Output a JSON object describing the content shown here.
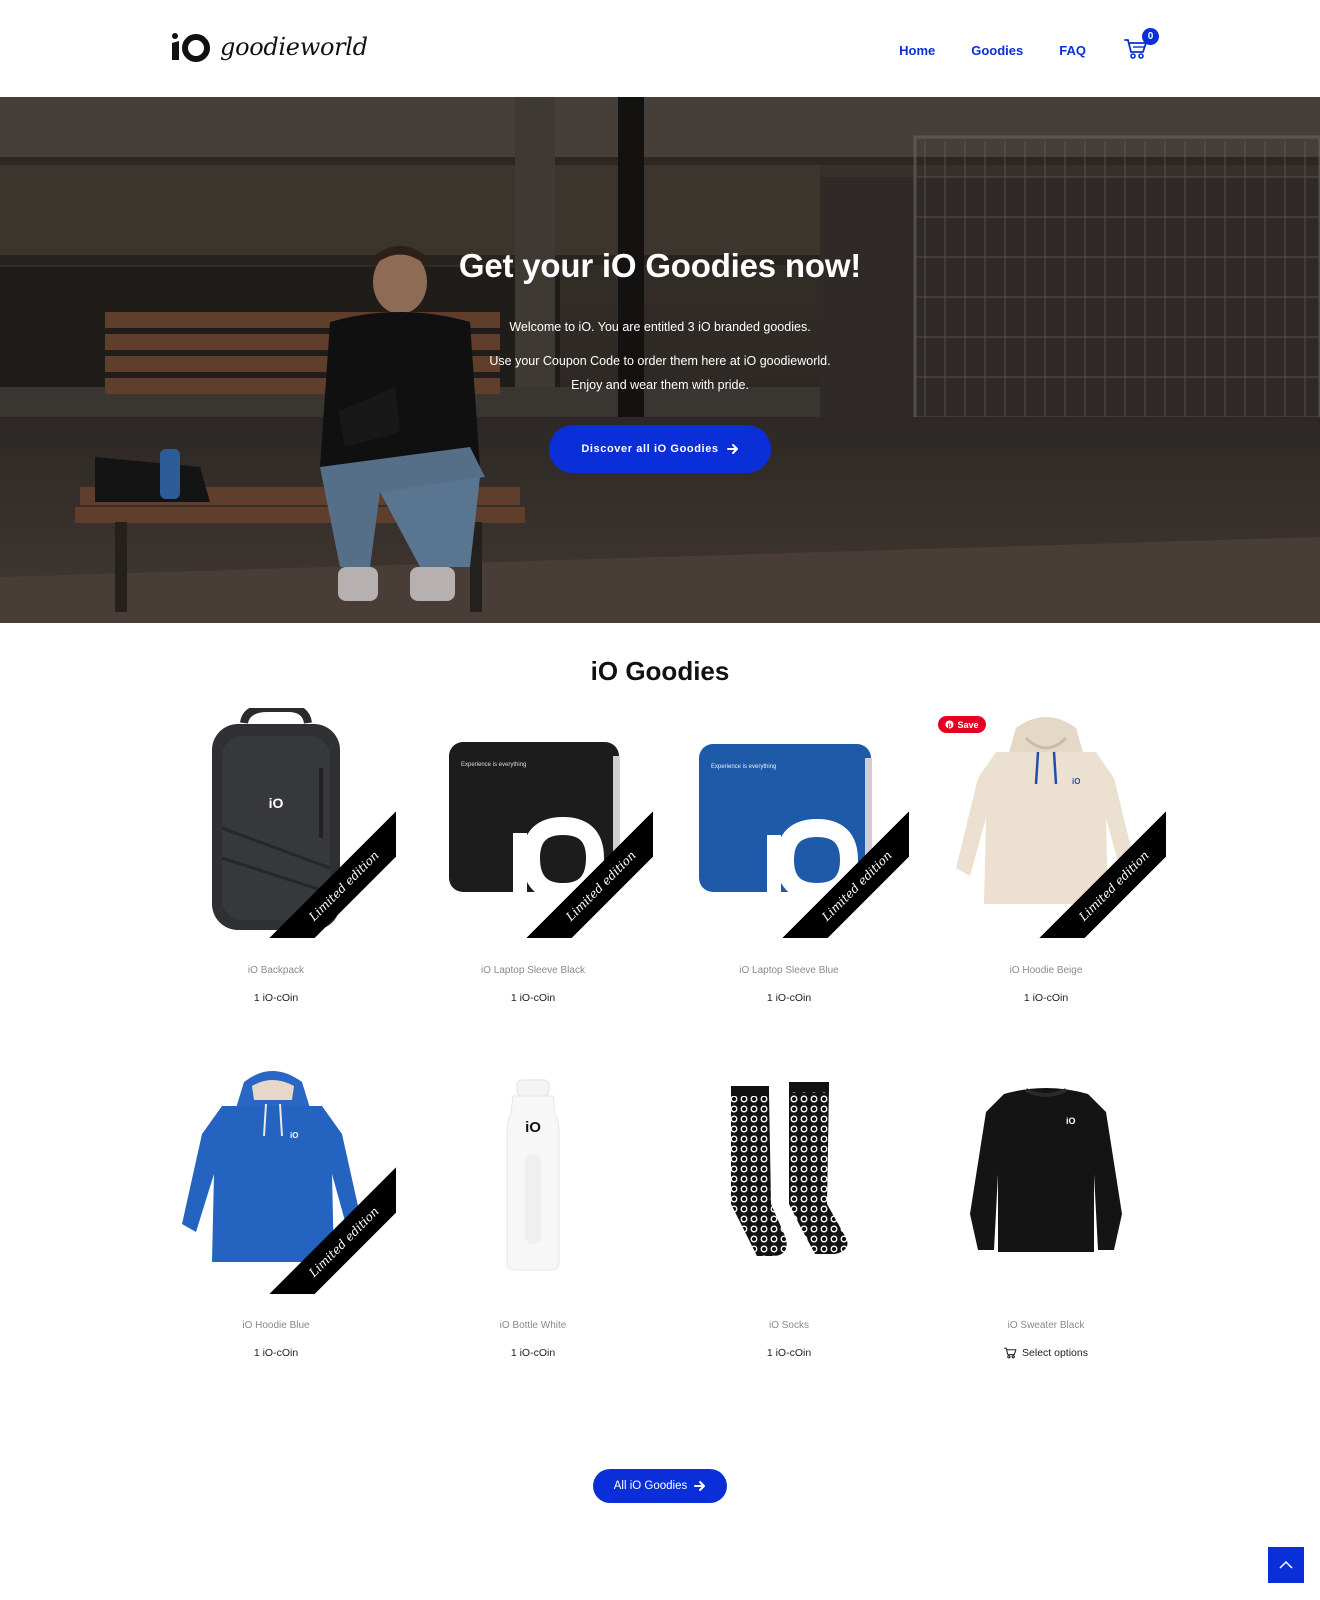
{
  "header": {
    "logo_text": "goodieworld",
    "nav": [
      "Home",
      "Goodies",
      "FAQ"
    ],
    "cart_count": "0"
  },
  "hero": {
    "title": "Get your iO Goodies now!",
    "line1": "Welcome to iO. You are entitled 3 iO branded goodies.",
    "line2": "Use your Coupon Code to order them here at iO goodieworld.",
    "line3": "Enjoy and wear them with pride.",
    "button": "Discover all iO Goodies"
  },
  "section": {
    "title": "iO Goodies"
  },
  "products": [
    {
      "name": "iO Backpack",
      "price": "1 iO-cOin",
      "ribbon": "Limited edition"
    },
    {
      "name": "iO Laptop Sleeve Black",
      "price": "1 iO-cOin",
      "ribbon": "Limited edition"
    },
    {
      "name": "iO Laptop Sleeve Blue",
      "price": "1 iO-cOin",
      "ribbon": "Limited edition"
    },
    {
      "name": "iO Hoodie Beige",
      "price": "1 iO-cOin",
      "ribbon": "Limited edition"
    },
    {
      "name": "iO Hoodie Blue",
      "price": "1 iO-cOin",
      "ribbon": "Limited edition"
    },
    {
      "name": "iO Bottle White",
      "price": "1 iO-cOin"
    },
    {
      "name": "iO Socks",
      "price": "1 iO-cOin"
    },
    {
      "name": "iO Sweater Black",
      "select": "Select options"
    }
  ],
  "print_text": {
    "sleeve": "Experience is everything",
    "logo": "iO"
  },
  "pinterest": {
    "label": "Save"
  },
  "all_button": "All iO Goodies",
  "colors": {
    "accent": "#0a2fd9",
    "pinterest": "#e60023"
  }
}
